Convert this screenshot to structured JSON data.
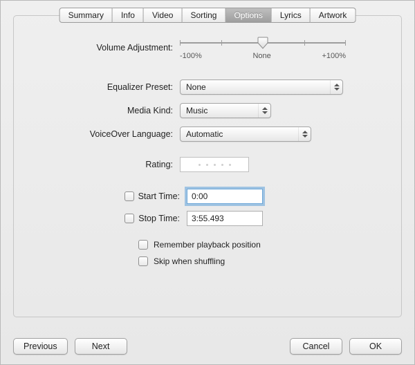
{
  "tabs": [
    {
      "label": "Summary"
    },
    {
      "label": "Info"
    },
    {
      "label": "Video"
    },
    {
      "label": "Sorting"
    },
    {
      "label": "Options"
    },
    {
      "label": "Lyrics"
    },
    {
      "label": "Artwork"
    }
  ],
  "active_tab_index": 4,
  "labels": {
    "volume": "Volume Adjustment:",
    "equalizer": "Equalizer Preset:",
    "media_kind": "Media Kind:",
    "voiceover": "VoiceOver Language:",
    "rating": "Rating:",
    "start_time": "Start Time:",
    "stop_time": "Stop Time:",
    "remember": "Remember playback position",
    "skip": "Skip when shuffling"
  },
  "slider": {
    "min_label": "-100%",
    "mid_label": "None",
    "max_label": "+100%"
  },
  "values": {
    "equalizer": "None",
    "media_kind": "Music",
    "voiceover": "Automatic",
    "start_time": "0:00",
    "stop_time": "3:55.493"
  },
  "buttons": {
    "previous": "Previous",
    "next": "Next",
    "cancel": "Cancel",
    "ok": "OK"
  }
}
